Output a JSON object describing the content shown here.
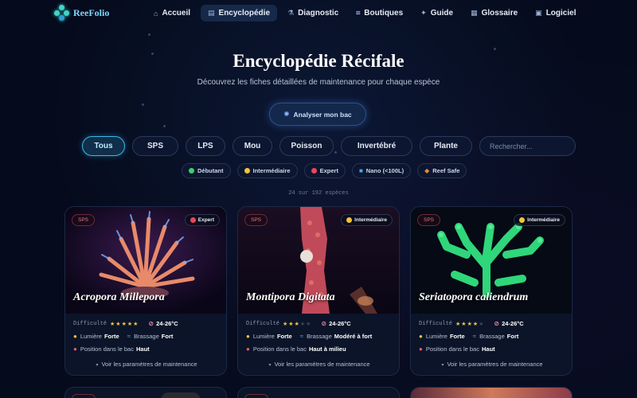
{
  "brand": {
    "name": "ReeFolio"
  },
  "nav": [
    {
      "label": "Accueil",
      "icon": "home-icon",
      "active": false
    },
    {
      "label": "Encyclopédie",
      "icon": "book-icon",
      "active": true
    },
    {
      "label": "Diagnostic",
      "icon": "flask-icon",
      "active": false
    },
    {
      "label": "Boutiques",
      "icon": "shop-icon",
      "active": false
    },
    {
      "label": "Guide",
      "icon": "compass-icon",
      "active": false
    },
    {
      "label": "Glossaire",
      "icon": "glossary-icon",
      "active": false
    },
    {
      "label": "Logiciel",
      "icon": "software-icon",
      "active": false
    }
  ],
  "hero": {
    "title": "Encyclopédie Récifale",
    "subtitle": "Découvrez les fiches détaillées de maintenance pour chaque espèce",
    "cta": "Analyser mon bac"
  },
  "filters": {
    "categories": [
      "Tous",
      "SPS",
      "LPS",
      "Mou",
      "Poisson",
      "Invertébré",
      "Plante"
    ],
    "active": "Tous",
    "search_placeholder": "Rechercher..."
  },
  "tags": [
    {
      "label": "Débutant",
      "color": "#3ecf6a"
    },
    {
      "label": "Intermédiaire",
      "color": "#f2c43a"
    },
    {
      "label": "Expert",
      "color": "#e8465a"
    },
    {
      "label": "Nano (<100L)",
      "color": "#4aa8e8"
    },
    {
      "label": "Reef Safe",
      "color": "#e88a3a"
    }
  ],
  "count_text": "24 sur 192 espèces",
  "card_labels": {
    "difficulty": "Difficulté",
    "light": "Lumière",
    "flow": "Brassage",
    "position": "Position dans le bac",
    "details": "Voir les paramètres de maintenance"
  },
  "cards": [
    {
      "type": "SPS",
      "level": "Expert",
      "level_color": "#e8465a",
      "name": "Acropora Millepora",
      "difficulty": 5,
      "temp": "24-26°C",
      "light": "Forte",
      "flow": "Fort",
      "position": "Haut"
    },
    {
      "type": "SPS",
      "level": "Intermédiaire",
      "level_color": "#f2c43a",
      "name": "Montipora Digitata",
      "difficulty": 3,
      "temp": "24-26°C",
      "light": "Forte",
      "flow": "Modéré à fort",
      "position": "Haut à milieu"
    },
    {
      "type": "SPS",
      "level": "Intermédiaire",
      "level_color": "#f2c43a",
      "name": "Seriatopora caliendrum",
      "difficulty": 4,
      "temp": "24-26°C",
      "light": "Forte",
      "flow": "Fort",
      "position": "Haut"
    }
  ]
}
